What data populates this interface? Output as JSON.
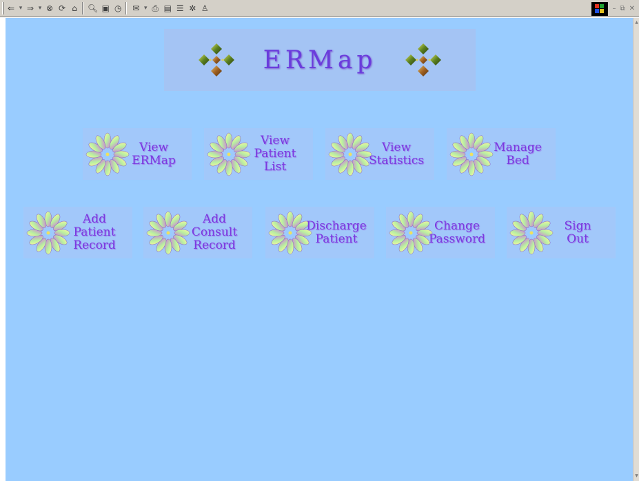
{
  "toolbar": {
    "buttons": [
      "back-icon",
      "forward-icon",
      "stop-icon",
      "refresh-icon",
      "home-icon",
      "search-icon",
      "favorites-icon",
      "history-icon",
      "mail-icon",
      "print-icon",
      "edit-icon",
      "discuss-icon",
      "messenger-icon",
      "related-icon"
    ]
  },
  "banner": {
    "title": "ERMap"
  },
  "menu": {
    "row1": [
      {
        "lines": [
          "View",
          "ERMap"
        ]
      },
      {
        "lines": [
          "View",
          "Patient",
          "List"
        ]
      },
      {
        "lines": [
          "View",
          "Statistics"
        ]
      },
      {
        "lines": [
          "Manage",
          "Bed"
        ]
      }
    ],
    "row2": [
      {
        "lines": [
          "Add",
          "Patient",
          "Record"
        ]
      },
      {
        "lines": [
          "Add",
          "Consult",
          "Record"
        ]
      },
      {
        "lines": [
          "Discharge",
          "Patient"
        ]
      },
      {
        "lines": [
          "Change",
          "Password"
        ]
      },
      {
        "lines": [
          "Sign",
          "Out"
        ]
      }
    ]
  },
  "colors": {
    "page_background": "#99ccff",
    "button_background": "#a2c8fa",
    "label_color": "#7a3ae0"
  }
}
